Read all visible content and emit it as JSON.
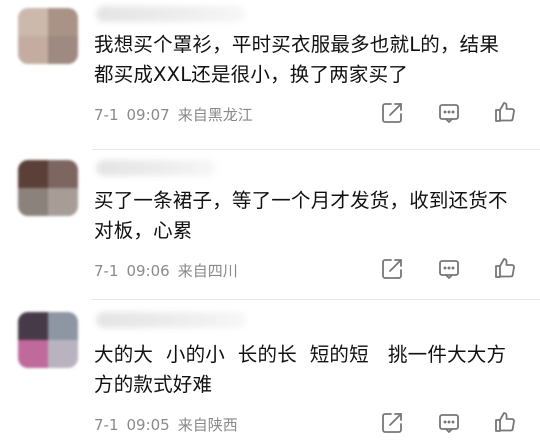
{
  "comments": [
    {
      "text": "我想买个罩衫，平时买衣服最多也就L的，结果都买成XXL还是很小，换了两家买了",
      "date": "7-1",
      "time": "09:07",
      "location": "来自黑龙江",
      "avatar_colors": [
        "#cdb8ac",
        "#a99286",
        "#c4aca0",
        "#9e8a80"
      ]
    },
    {
      "text": "买了一条裙子，等了一个月才发货，收到还货不对板，心累",
      "date": "7-1",
      "time": "09:06",
      "location": "来自四川",
      "avatar_colors": [
        "#5a4038",
        "#7d6560",
        "#8c827c",
        "#a89c97"
      ]
    },
    {
      "text": "大的大  小的小  长的长  短的短   挑一件大大方方的款式好难",
      "date": "7-1",
      "time": "09:05",
      "location": "来自陕西",
      "avatar_colors": [
        "#473a48",
        "#8e96a4",
        "#c06a9c",
        "#b9b3c0"
      ]
    }
  ],
  "icons": {
    "share": "share-icon",
    "comment": "comment-icon",
    "like": "like-icon"
  },
  "colors": {
    "text": "#111111",
    "meta": "#8a8a8a",
    "icon": "#777777",
    "divider": "#e6e6e6"
  }
}
